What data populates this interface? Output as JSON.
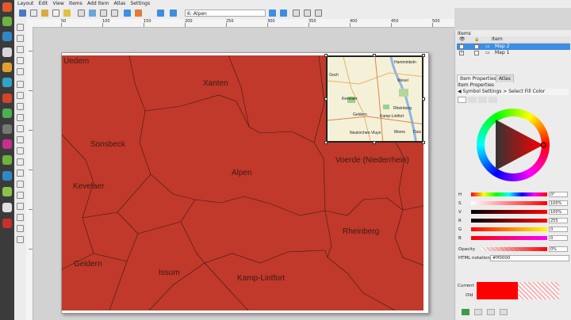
{
  "menu": [
    "Layout",
    "Edit",
    "View",
    "Items",
    "Add Item",
    "Atlas",
    "Settings"
  ],
  "toolbar": {
    "atlas_feature": "6: Alpen"
  },
  "ruler_h_labels": [
    "50",
    "100",
    "150",
    "200",
    "250",
    "300",
    "350",
    "400",
    "450",
    "500"
  ],
  "ruler_v_labels": [
    "50",
    "100",
    "150",
    "200",
    "250",
    "300"
  ],
  "map_labels": [
    "Uedem",
    "Xanten",
    "Sonsbeck",
    "Alpen",
    "Kevelaer",
    "Voerde (Niederrhein)",
    "Rheinberg",
    "Geldern",
    "Issum",
    "Kamp-Lintfort"
  ],
  "inset_labels": [
    "Hamminkeln",
    "Goch",
    "Wesel",
    "Kevelaer",
    "Rheinberg",
    "Geldern",
    "Kamp-Lintfort",
    "Neukirchen-Vluyn",
    "Moers",
    "Duis"
  ],
  "items_panel": {
    "title": "Items",
    "col_item": "Item",
    "rows": [
      {
        "label": "Map 2",
        "selected": true
      },
      {
        "label": "Map 1",
        "selected": false
      }
    ]
  },
  "tabs": [
    "Item Properties",
    "Atlas"
  ],
  "props": {
    "title": "Item Properties",
    "breadcrumb": "Symbol Settings > Select Fill Color"
  },
  "sliders": [
    {
      "name": "H",
      "value": "0°"
    },
    {
      "name": "S",
      "value": "100%"
    },
    {
      "name": "V",
      "value": "100%"
    },
    {
      "name": "R",
      "value": "255"
    },
    {
      "name": "G",
      "value": "0"
    },
    {
      "name": "B",
      "value": "0"
    }
  ],
  "opacity": {
    "label": "Opacity",
    "value": "0%"
  },
  "html_notation": {
    "label": "HTML notation",
    "value": "#ff0000"
  },
  "current_label": "Current",
  "old_label": "Old",
  "colors": {
    "fill": "#c0392b",
    "current": "#ff0000",
    "accent": "#3d8ee0"
  }
}
